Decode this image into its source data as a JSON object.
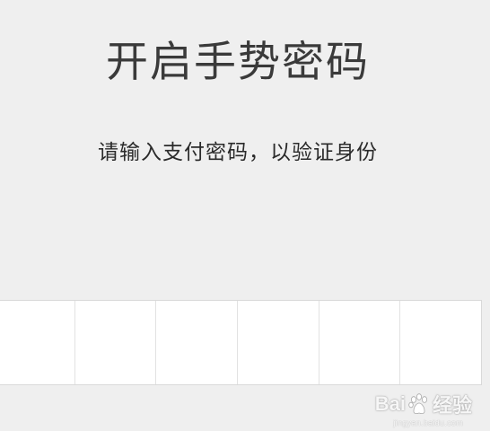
{
  "title": "开启手势密码",
  "instruction": "请输入支付密码，以验证身份",
  "pin_cells": [
    "",
    "",
    "",
    "",
    "",
    ""
  ],
  "watermark": {
    "brand_left": "Bai",
    "brand_right": "经验",
    "url": "jingyan.baidu.com"
  }
}
